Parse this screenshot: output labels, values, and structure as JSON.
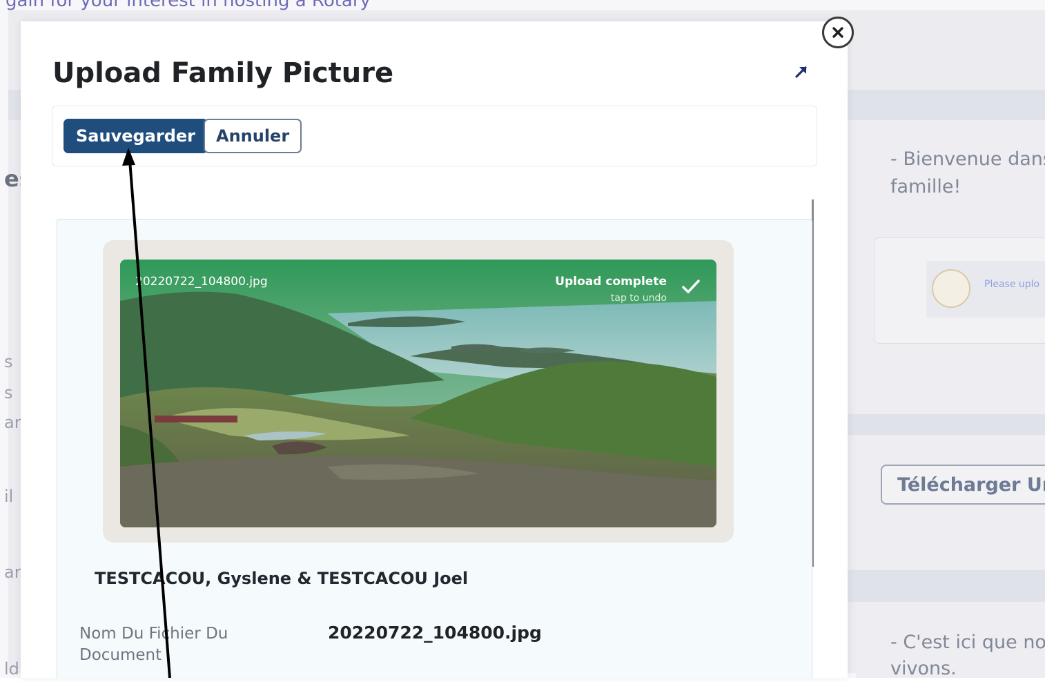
{
  "background": {
    "top_text": "gain for your interest in hosting a Rotary",
    "welcome_text_line1": "- Bienvenue dans",
    "welcome_text_line2": "famille!",
    "logo_text": "Please uplo",
    "upload_button_label": "Télécharger Une",
    "living_text_line1": "- C'est ici que nou",
    "living_text_line2": "vivons.",
    "left_letters": [
      "es",
      "s",
      "s",
      "ar",
      "il",
      "ar",
      "ld"
    ]
  },
  "modal": {
    "title": "Upload Family Picture",
    "toolbar": {
      "save_label": "Sauvegarder",
      "cancel_label": "Annuler"
    },
    "upload": {
      "filename": "20220722_104800.jpg",
      "status": "Upload complete",
      "undo_hint": "tap to undo"
    },
    "family_name": "TESTCACOU, Gyslene & TESTCACOU Joel",
    "field": {
      "label": "Nom Du Fichier Du",
      "label_cont": "Document",
      "value": "20220722_104800.jpg"
    }
  },
  "icons": {
    "close": "close-icon",
    "expand": "expand-arrow-icon",
    "check": "check-icon"
  },
  "colors": {
    "primary_button": "#1f4e7e",
    "upload_complete_green": "#3a9a5c",
    "background_overlay": "#ececf0"
  }
}
